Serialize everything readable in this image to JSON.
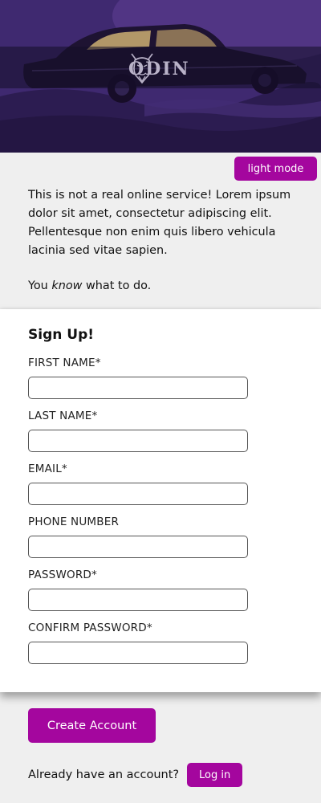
{
  "header": {
    "brand": "ODIN"
  },
  "mode_toggle": {
    "label": "light mode"
  },
  "intro": {
    "paragraph": "This is not a real online service! Lorem ipsum dolor sit amet, consectetur adipiscing elit. Pellentesque non enim quis libero vehicula lacinia sed vitae sapien.",
    "line_before": "You ",
    "line_emph": "know",
    "line_after": " what to do."
  },
  "form": {
    "title": "Sign Up!",
    "fields": [
      {
        "label": "FIRST NAME*",
        "value": ""
      },
      {
        "label": "LAST NAME*",
        "value": ""
      },
      {
        "label": "EMAIL*",
        "value": ""
      },
      {
        "label": "PHONE NUMBER",
        "value": ""
      },
      {
        "label": "PASSWORD*",
        "value": ""
      },
      {
        "label": "CONFIRM PASSWORD*",
        "value": ""
      }
    ]
  },
  "actions": {
    "create_label": "Create Account",
    "login_prompt": "Already have an account?",
    "login_label": "Log in"
  },
  "colors": {
    "accent": "#a4069e",
    "page_bg": "#efefef",
    "card_bg": "#ffffff",
    "hero_tint": "#3b2766"
  }
}
